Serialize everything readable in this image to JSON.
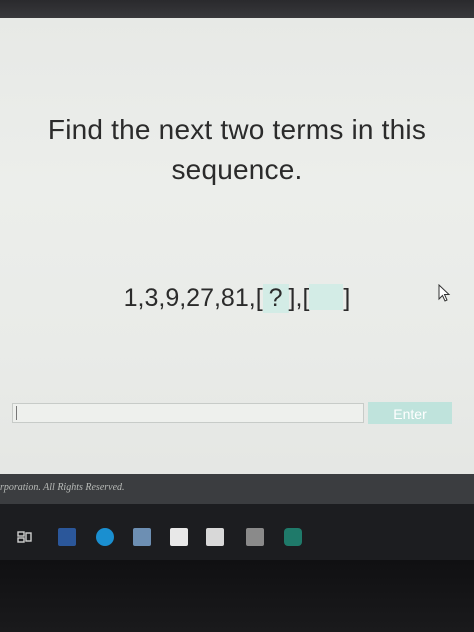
{
  "question": {
    "line1": "Find the next two terms in this",
    "line2": "sequence."
  },
  "sequence": {
    "terms": "1,3,9,27,81,",
    "blank1_open": "[",
    "blank1_mark": " ? ",
    "blank1_close": "],",
    "blank2_open": "[",
    "blank2_close": "]"
  },
  "answer_input": {
    "value": ""
  },
  "enter_button": {
    "label": "Enter"
  },
  "footer": {
    "copyright": "rporation. All Rights Reserved."
  },
  "icons": [
    "mouse-pointer-icon",
    "task-view-icon",
    "word-icon",
    "edge-icon",
    "photos-icon",
    "store-icon",
    "mail-icon",
    "calculator-icon",
    "app-icon"
  ],
  "colors": {
    "blank_highlight": "#d3ece6",
    "button": "#bfe3dc",
    "screen_bg": "#e9ebe8"
  }
}
